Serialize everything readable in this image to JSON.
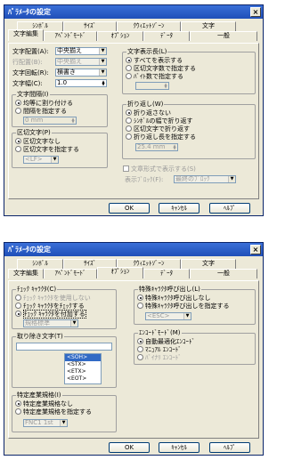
{
  "d1": {
    "title": "ﾊﾟﾗﾒｰﾀの設定",
    "close": "×",
    "tabs_row1": [
      "ｼﾝﾎﾞﾙ",
      "ｻｲｽﾞ",
      "ｸｳｨｴｯﾄｿﾞｰﾝ",
      "文字"
    ],
    "tabs_row2": [
      "文字編集",
      "ｱﾍﾟﾝﾄﾞﾓｰﾄﾞ",
      "ｵﾌﾟｼｮﾝ",
      "ﾃﾞｰﾀ",
      "一般"
    ],
    "haichi_label": "文字配置(A):",
    "haichi_val": "中央揃え",
    "gyou_label": "行配置(B):",
    "gyou_val": "中央揃え",
    "kaiten_label": "文字回転(R):",
    "kaiten_val": "横書き",
    "haba_label": "文字幅(C):",
    "haba_val": "1.0",
    "kankaku_title": "文字間隔(I)",
    "kankaku_o1": "均等に割り付ける",
    "kankaku_o2": "間隔を指定する",
    "kankaku_val": "0 mm",
    "kugiri_title": "区切文字(P)",
    "kugiri_o1": "区切文字なし",
    "kugiri_o2": "区切文字を指定する",
    "kugiri_val": "<LF>",
    "hyouji_title": "文字表示長(L)",
    "hyouji_o1": "すべてを表示する",
    "hyouji_o2": "区切文字数で指定する",
    "hyouji_o3": "ﾊﾞｲﾄ数で指定する",
    "hyouji_val": "",
    "orikaeshi_title": "折り返し(W)",
    "ori_o1": "折り返さない",
    "ori_o2": "ｼﾝﾎﾞﾙの幅で折り返す",
    "ori_o3": "区切文字で折り返す",
    "ori_o4": "折り返し長を指定する",
    "ori_val": "25.4 mm",
    "keishiki": "文章形式で表示する(S)",
    "block_label": "表示ﾌﾞﾛｯｸ(F):",
    "block_val": "最終のﾌﾞﾛｯｸ",
    "ok": "OK",
    "cancel": "ｷｬﾝｾﾙ",
    "help": "ﾍﾙﾌﾟ"
  },
  "d2": {
    "title": "ﾊﾟﾗﾒｰﾀの設定",
    "close": "×",
    "tabs_row1": [
      "ｼﾝﾎﾞﾙ",
      "ｻｲｽﾞ",
      "ｸｳｨｴｯﾄｿﾞｰﾝ",
      "文字"
    ],
    "tabs_row2": [
      "文字編集",
      "ｱﾍﾟﾝﾄﾞﾓｰﾄﾞ",
      "ｵﾌﾟｼｮﾝ",
      "ﾃﾞｰﾀ",
      "一般"
    ],
    "check_title": "ﾁｪｯｸ ｷｬﾗｸﾀ(C)",
    "check_o1": "ﾁｪｯｸ ｷｬﾗｸﾀを使用しない",
    "check_o2": "ﾁｪｯｸ ｷｬﾗｸﾀをﾁｪｯｸする",
    "check_o3": "ﾁｪｯｸ ｷｬﾗｸﾀを付加する",
    "check_val": "規格標準",
    "nozoki_title": "取り除き文字(T)",
    "nozoki_input": "",
    "nozoki_items": [
      "<SOH>",
      "<STX>",
      "<ETX>",
      "<EOT>"
    ],
    "sangyou_title": "特定産業規格(I)",
    "sangyou_o1": "特定産業規格なし",
    "sangyou_o2": "特定産業規格を指定する",
    "sangyou_val": "FNC1 1st",
    "tokushu_title": "特殊ｷｬﾗｸﾀ呼び出し(L)",
    "tokushu_o1": "特殊ｷｬﾗｸﾀ呼び出しなし",
    "tokushu_o2": "特殊ｷｬﾗｸﾀ呼び出しを指定する",
    "tokushu_val": "<ESC>",
    "encode_title": "ｴﾝｺｰﾄﾞﾓｰﾄﾞ(M)",
    "enc_o1": "自動最適化ｴﾝｺｰﾄﾞ",
    "enc_o2": "ﾏﾆｭｱﾙ ｴﾝｺｰﾄﾞ",
    "enc_o3": "ﾊﾞｲﾅﾘ ｴﾝｺｰﾄﾞ",
    "ok": "OK",
    "cancel": "ｷｬﾝｾﾙ",
    "help": "ﾍﾙﾌﾟ"
  }
}
